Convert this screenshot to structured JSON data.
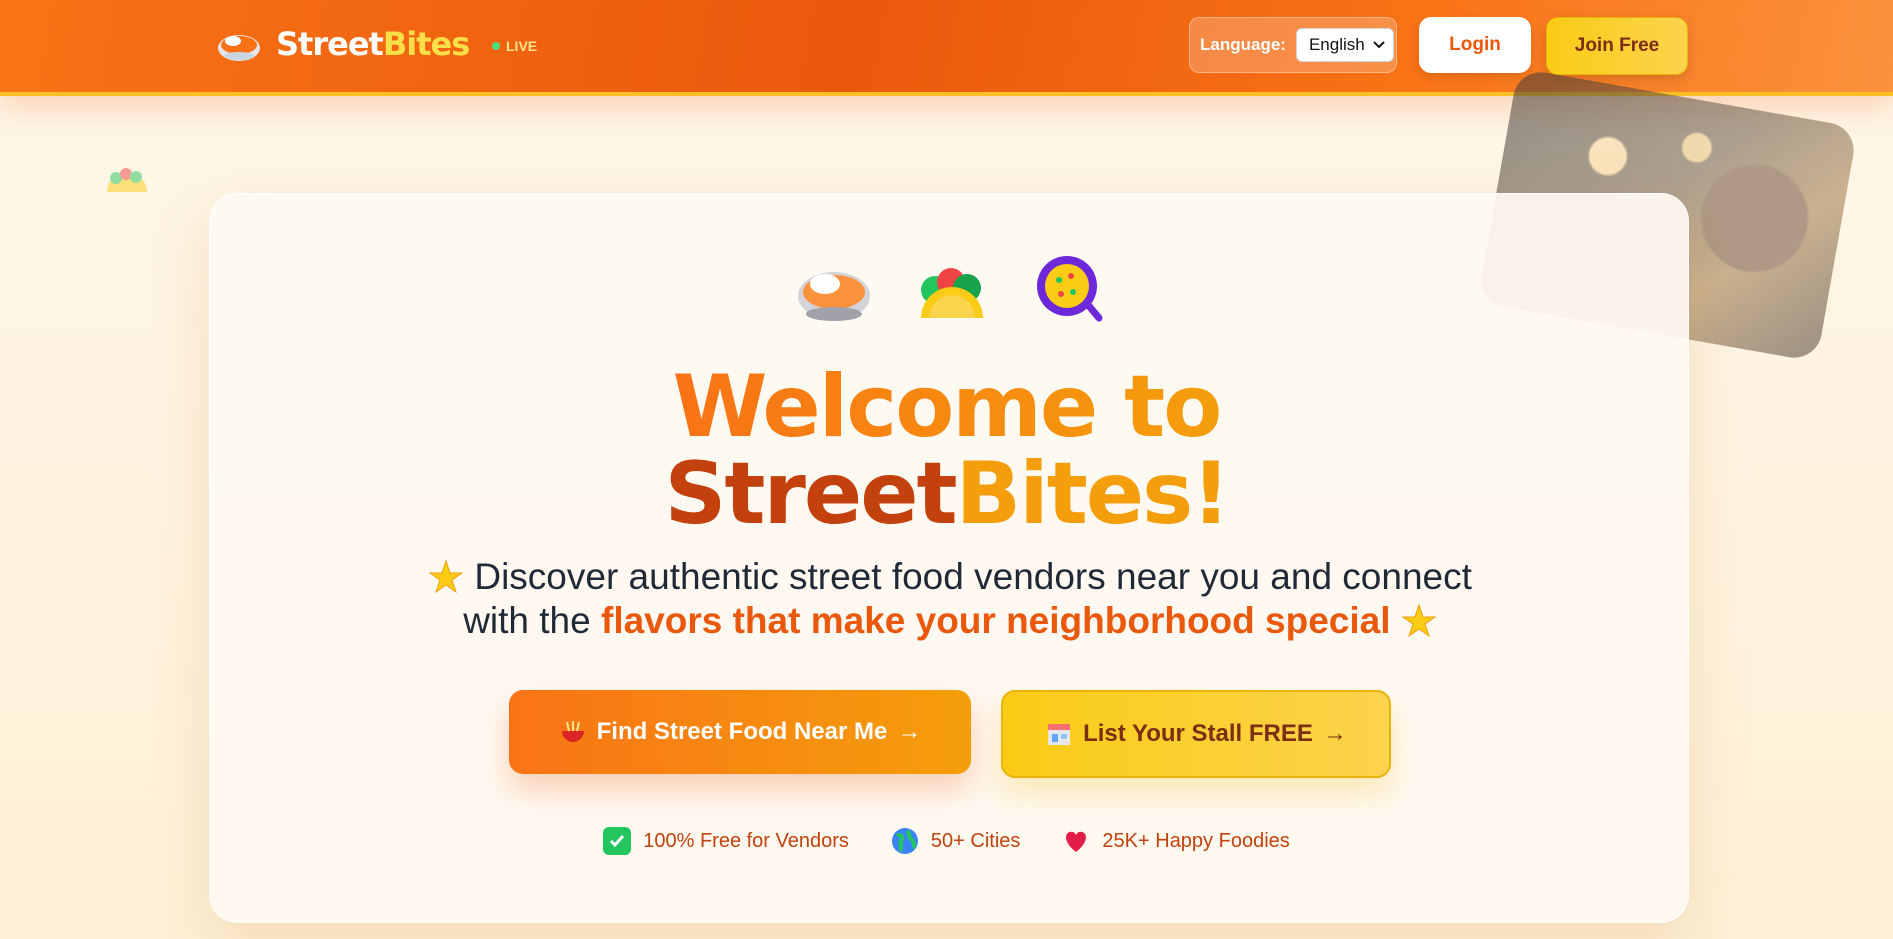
{
  "header": {
    "brand_part1": "Street",
    "brand_part2": "Bites",
    "live_label": "LIVE",
    "language_label": "Language:",
    "language_value": "English",
    "login_label": "Login",
    "join_label": "Join Free"
  },
  "hero": {
    "title_line1": "Welcome to",
    "title_street": "Street",
    "title_bites": "Bites!",
    "subtitle_plain": "Discover authentic street food vendors near you and connect with the",
    "subtitle_highlight": "flavors that make your neighborhood special",
    "cta_find": "Find Street Food Near Me",
    "cta_list": "List Your Stall FREE",
    "arrow": "→",
    "stats": [
      {
        "label": "100% Free for Vendors",
        "icon": "check-icon"
      },
      {
        "label": "50+ Cities",
        "icon": "globe-icon"
      },
      {
        "label": "25K+ Happy Foodies",
        "icon": "heart-icon"
      }
    ]
  },
  "colors": {
    "brand_orange": "#f97316",
    "accent_yellow": "#facc15",
    "deep_orange": "#c2410c"
  }
}
